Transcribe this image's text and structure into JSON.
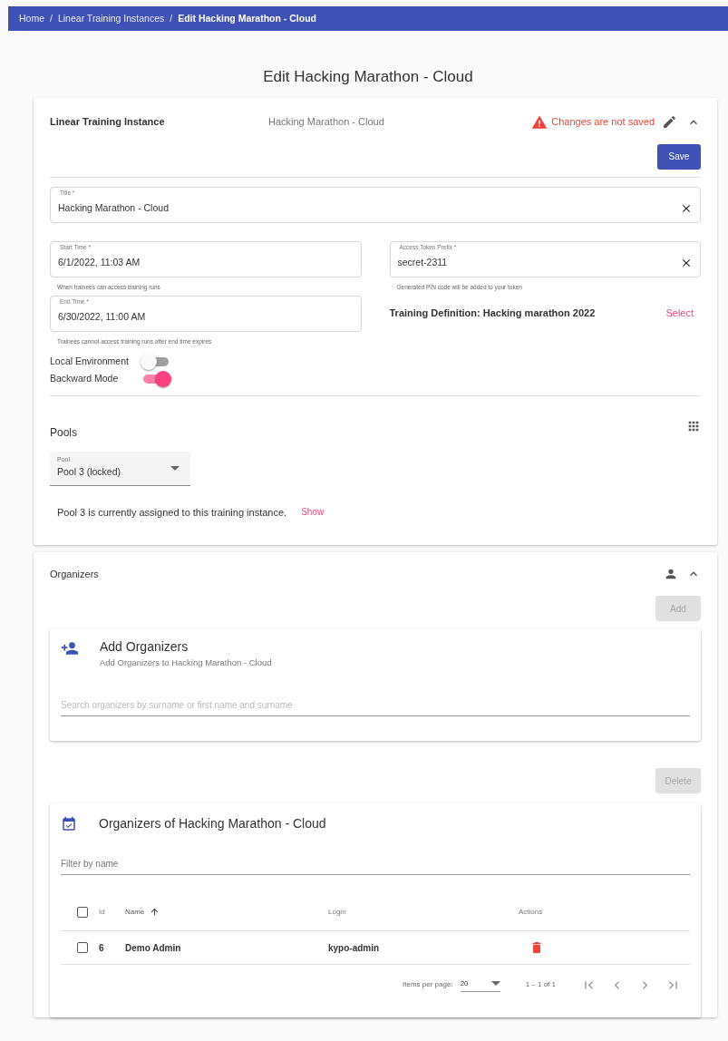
{
  "breadcrumbs": [
    {
      "label": "Home",
      "current": false
    },
    {
      "separator": "/",
      "label": "Linear Training Instances",
      "current": false
    },
    {
      "separator": "/",
      "label": "Edit Hacking Marathon - Cloud",
      "current": true
    }
  ],
  "page_title": "Edit Hacking Marathon - Cloud",
  "instance_card": {
    "title": "Linear Training Instance",
    "subtitle": "Hacking Marathon - Cloud",
    "warning": "Changes are not saved",
    "expanded": true,
    "save_button": "Save",
    "title_field": {
      "label": "Title *",
      "value": "Hacking Marathon - Cloud"
    },
    "start_time": {
      "label": "Start Time *",
      "value": "6/1/2022, 11:03 AM",
      "hint": "When trainees can access training runs"
    },
    "access_token": {
      "label": "Access Token Prefix *",
      "value": "secret-2311",
      "hint": "Generated PIN code will be added to your token"
    },
    "end_time": {
      "label": "End Time *",
      "value": "6/30/2022, 11:00 AM",
      "hint": "Trainees cannot access training runs after end time expires"
    },
    "training_definition": {
      "text": "Training Definition: Hacking marathon 2022",
      "action": "Select"
    },
    "toggles": [
      {
        "label": "Local Environment",
        "on": false
      },
      {
        "label": "Backward Mode",
        "on": true
      }
    ],
    "pools": {
      "title": "Pools",
      "select_label": "Pool",
      "select_value": "Pool 3 (locked)",
      "message": "Pool 3 is currently assigned to this training instance.",
      "action": "Show"
    }
  },
  "organizers_card": {
    "title": "Organizers",
    "expanded": true,
    "add_button": {
      "label": "Add",
      "disabled": true
    },
    "add_panel": {
      "title": "Add Organizers",
      "subtitle": "Add Organizers to Hacking Marathon - Cloud",
      "placeholder": "Search organizers by surname or first name and surname"
    },
    "delete_button": {
      "label": "Delete",
      "disabled": true
    },
    "table_panel": {
      "title": "Organizers of Hacking Marathon - Cloud",
      "filter_placeholder": "Filter by name",
      "all_selected": false,
      "columns": [
        {
          "label": "Id",
          "sorted": false
        },
        {
          "label": "Name",
          "sorted": true
        },
        {
          "label": "Login",
          "sorted": false
        },
        {
          "label": "Actions",
          "sorted": false
        }
      ],
      "rows": [
        {
          "selected": false,
          "id": "6",
          "name": "Demo Admin",
          "login": "kypo-admin"
        }
      ],
      "paginator": {
        "label": "Items per page:",
        "page_size": "20",
        "range": "1 – 1 of 1"
      }
    }
  }
}
